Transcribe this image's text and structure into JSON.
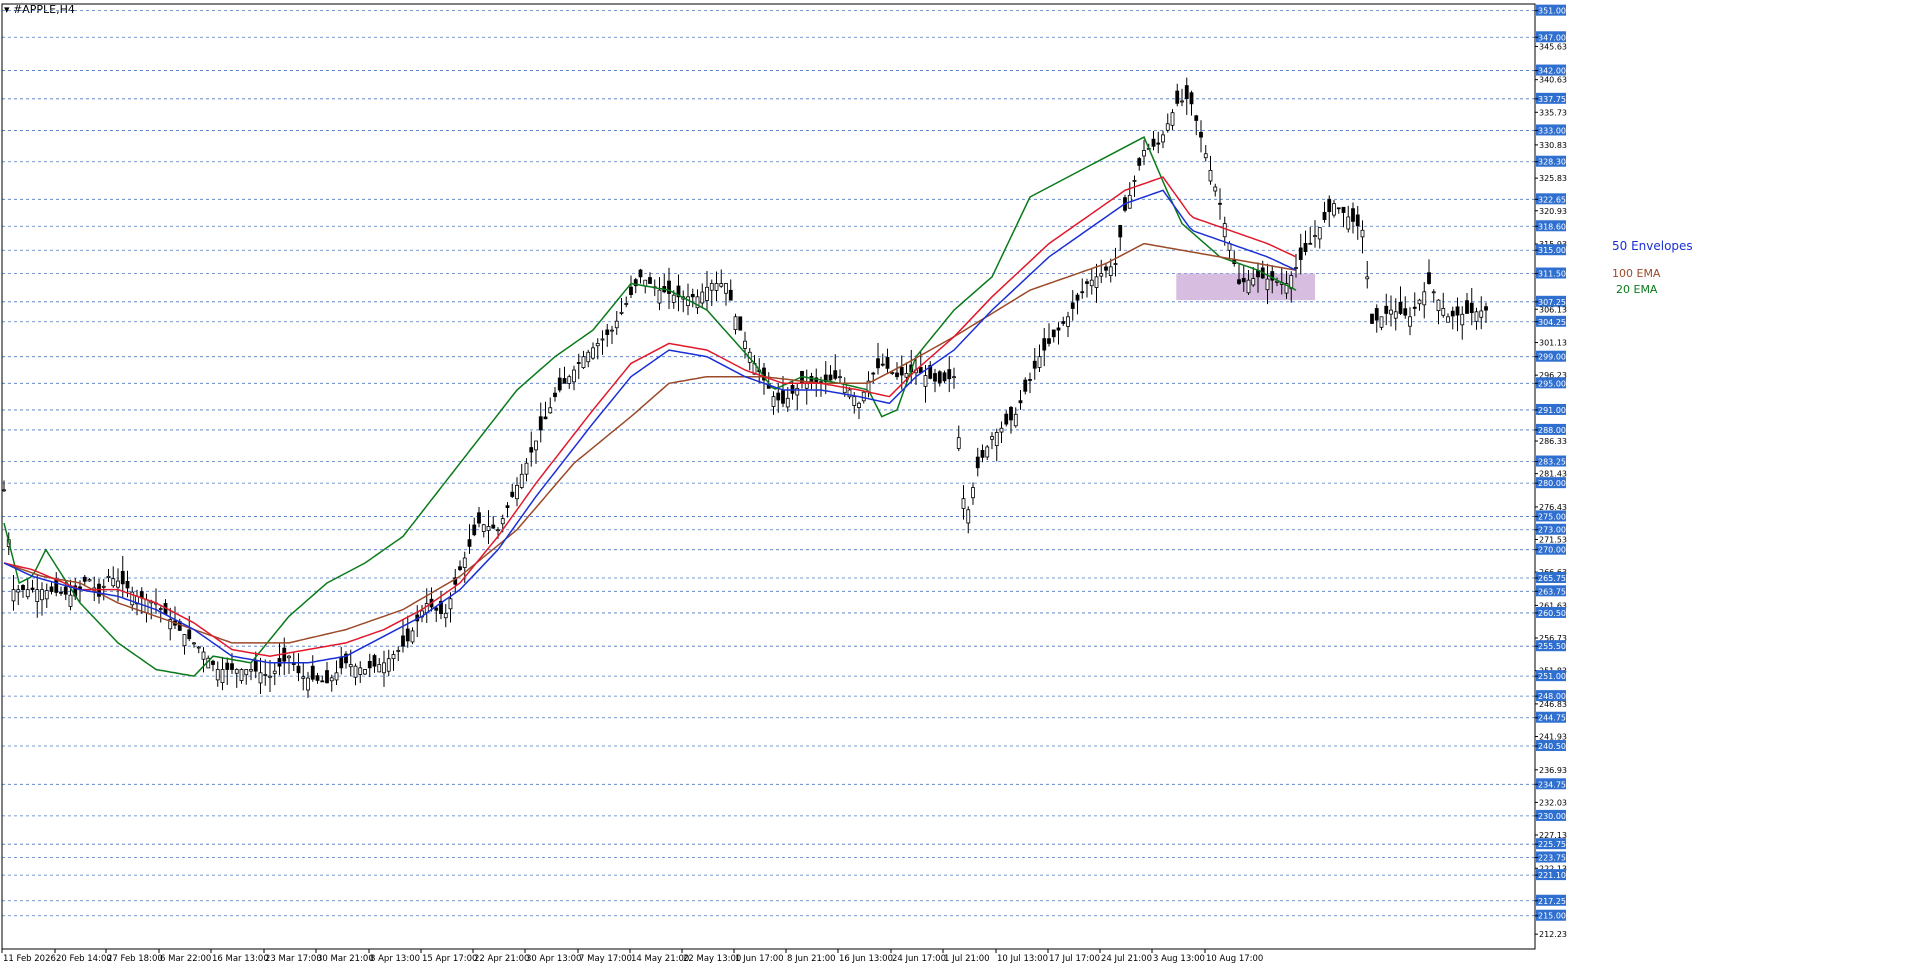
{
  "window": {
    "title": "▾ #APPLE,H4"
  },
  "colors": {
    "grid": "#4a78c8",
    "axis": "#000000",
    "candle": "#000000",
    "ema20": "#0a7a1a",
    "ema100": "#9b4a2a",
    "env_upper": "#e0192b",
    "env_lower": "#1a2fd6",
    "zone": "#c9a7d4",
    "tag_bg": "#2f6fd0",
    "tag_text": "#ffffff"
  },
  "annotations": {
    "envelopes": "50 Envelopes",
    "ema100": "100 EMA",
    "ema20": "20 EMA"
  },
  "chart_data": {
    "type": "candlestick",
    "symbol": "#APPLE",
    "timeframe": "H4",
    "ylim": [
      210,
      352
    ],
    "ticks": [
      "351.00",
      "347.00",
      "345.63",
      "342.00",
      "340.63",
      "337.75",
      "335.73",
      "333.00",
      "330.83",
      "328.30",
      "325.83",
      "322.65",
      "320.93",
      "318.60",
      "315.93",
      "315.00",
      "311.50",
      "307.25",
      "306.13",
      "304.25",
      "301.13",
      "299.00",
      "296.23",
      "295.00",
      "291.00",
      "288.00",
      "286.33",
      "283.25",
      "281.43",
      "280.00",
      "276.43",
      "275.00",
      "273.00",
      "271.53",
      "270.00",
      "266.63",
      "265.75",
      "263.75",
      "261.63",
      "260.50",
      "256.73",
      "255.50",
      "251.83",
      "251.00",
      "248.00",
      "246.83",
      "244.75",
      "241.93",
      "240.50",
      "236.93",
      "234.75",
      "232.03",
      "230.00",
      "227.13",
      "225.75",
      "223.75",
      "222.13",
      "221.10",
      "217.25",
      "215.00",
      "212.23"
    ],
    "tagged_levels": [
      351.0,
      347.0,
      342.0,
      337.75,
      333.0,
      328.3,
      322.65,
      318.6,
      315.0,
      311.5,
      307.25,
      304.25,
      299.0,
      295.0,
      291.0,
      288.0,
      283.25,
      280.0,
      275.0,
      273.0,
      270.0,
      265.75,
      263.75,
      260.5,
      255.5,
      251.0,
      248.0,
      244.75,
      240.5,
      234.75,
      230.0,
      225.75,
      223.75,
      221.1,
      217.25,
      215.0
    ],
    "x_labels": [
      "11 Feb 2026",
      "20 Feb 14:00",
      "27 Feb 18:00",
      "6 Mar 22:00",
      "16 Mar 13:00",
      "23 Mar 17:00",
      "30 Mar 21:00",
      "8 Apr 13:00",
      "15 Apr 17:00",
      "22 Apr 21:00",
      "30 Apr 13:00",
      "7 May 17:00",
      "14 May 21:00",
      "22 May 13:00",
      "1 Jun 17:00",
      "8 Jun 21:00",
      "16 Jun 13:00",
      "24 Jun 17:00",
      "1 Jul 21:00",
      "10 Jul 13:00",
      "17 Jul 17:00",
      "24 Jul 21:00",
      "3 Aug 13:00",
      "10 Aug 17:00"
    ],
    "bar_count": 247,
    "close_path": [
      [
        0,
        279
      ],
      [
        5,
        264
      ],
      [
        20,
        264
      ],
      [
        38,
        263
      ],
      [
        44,
        266
      ],
      [
        50,
        263
      ],
      [
        55,
        266
      ],
      [
        62,
        265
      ],
      [
        70,
        263
      ],
      [
        80,
        262
      ],
      [
        92,
        258
      ],
      [
        104,
        255
      ],
      [
        112,
        252
      ],
      [
        120,
        252
      ],
      [
        130,
        252
      ],
      [
        140,
        251
      ],
      [
        150,
        254
      ],
      [
        156,
        251
      ],
      [
        170,
        250
      ],
      [
        180,
        253
      ],
      [
        190,
        252
      ],
      [
        200,
        253
      ],
      [
        212,
        256
      ],
      [
        222,
        262
      ],
      [
        232,
        260
      ],
      [
        240,
        267
      ],
      [
        250,
        274
      ],
      [
        260,
        273
      ],
      [
        275,
        283
      ],
      [
        290,
        293
      ],
      [
        305,
        299
      ],
      [
        320,
        303
      ],
      [
        335,
        311
      ],
      [
        345,
        309
      ],
      [
        355,
        308
      ],
      [
        365,
        308
      ],
      [
        372,
        310
      ],
      [
        380,
        310
      ],
      [
        386,
        304
      ],
      [
        395,
        298
      ],
      [
        405,
        293
      ],
      [
        410,
        292
      ],
      [
        420,
        295
      ],
      [
        430,
        295
      ],
      [
        440,
        296
      ],
      [
        450,
        292
      ],
      [
        456,
        296
      ],
      [
        462,
        298
      ],
      [
        470,
        296
      ],
      [
        480,
        297
      ],
      [
        492,
        295
      ],
      [
        500,
        296
      ],
      [
        506,
        274
      ],
      [
        512,
        282
      ],
      [
        520,
        287
      ],
      [
        532,
        290
      ],
      [
        545,
        299
      ],
      [
        560,
        305
      ],
      [
        570,
        310
      ],
      [
        585,
        313
      ],
      [
        590,
        321
      ],
      [
        600,
        330
      ],
      [
        608,
        331
      ],
      [
        617,
        337
      ],
      [
        624,
        338
      ],
      [
        640,
        322
      ],
      [
        650,
        310
      ],
      [
        660,
        311
      ],
      [
        675,
        310
      ],
      [
        700,
        322
      ],
      [
        715,
        318
      ],
      [
        720,
        304
      ],
      [
        730,
        306
      ],
      [
        740,
        305
      ],
      [
        750,
        310
      ],
      [
        760,
        305
      ],
      [
        780,
        306
      ]
    ],
    "series": [
      {
        "name": "20 EMA",
        "values_path": [
          [
            0,
            274
          ],
          [
            8,
            265
          ],
          [
            15,
            266
          ],
          [
            22,
            270
          ],
          [
            40,
            262
          ],
          [
            60,
            256
          ],
          [
            80,
            252
          ],
          [
            100,
            251
          ],
          [
            110,
            254
          ],
          [
            130,
            253
          ],
          [
            150,
            260
          ],
          [
            170,
            265
          ],
          [
            190,
            268
          ],
          [
            210,
            272
          ],
          [
            240,
            283
          ],
          [
            270,
            294
          ],
          [
            290,
            299
          ],
          [
            310,
            303
          ],
          [
            330,
            310
          ],
          [
            350,
            309
          ],
          [
            370,
            306
          ],
          [
            395,
            298
          ],
          [
            405,
            294
          ],
          [
            420,
            296
          ],
          [
            440,
            295
          ],
          [
            455,
            294
          ],
          [
            462,
            290
          ],
          [
            470,
            291
          ],
          [
            480,
            299
          ],
          [
            500,
            306
          ],
          [
            520,
            311
          ],
          [
            540,
            323
          ],
          [
            560,
            326
          ],
          [
            580,
            329
          ],
          [
            600,
            332
          ],
          [
            612,
            324
          ],
          [
            620,
            319
          ],
          [
            640,
            314
          ],
          [
            660,
            312
          ],
          [
            680,
            309
          ]
        ]
      },
      {
        "name": "100 EMA",
        "values_path": [
          [
            0,
            268
          ],
          [
            20,
            266
          ],
          [
            40,
            265
          ],
          [
            60,
            262
          ],
          [
            90,
            259
          ],
          [
            120,
            256
          ],
          [
            150,
            256
          ],
          [
            180,
            258
          ],
          [
            210,
            261
          ],
          [
            240,
            266
          ],
          [
            270,
            273
          ],
          [
            300,
            283
          ],
          [
            330,
            290
          ],
          [
            350,
            295
          ],
          [
            370,
            296
          ],
          [
            400,
            296
          ],
          [
            430,
            295
          ],
          [
            455,
            295
          ],
          [
            475,
            298
          ],
          [
            500,
            302
          ],
          [
            540,
            309
          ],
          [
            580,
            313
          ],
          [
            600,
            316
          ],
          [
            620,
            315
          ],
          [
            640,
            314
          ],
          [
            680,
            312
          ]
        ]
      },
      {
        "name": "",
        "values_path": [
          [
            0,
            268
          ],
          [
            15,
            267
          ],
          [
            40,
            264
          ],
          [
            60,
            264
          ],
          [
            80,
            262
          ],
          [
            100,
            259
          ],
          [
            120,
            255
          ],
          [
            140,
            254
          ],
          [
            160,
            255
          ],
          [
            180,
            256
          ],
          [
            200,
            258
          ],
          [
            220,
            261
          ],
          [
            240,
            265
          ],
          [
            260,
            272
          ],
          [
            280,
            280
          ],
          [
            310,
            291
          ],
          [
            330,
            298
          ],
          [
            350,
            301
          ],
          [
            370,
            300
          ],
          [
            390,
            297
          ],
          [
            410,
            295
          ],
          [
            430,
            295
          ],
          [
            450,
            294
          ],
          [
            466,
            293
          ],
          [
            480,
            297
          ],
          [
            500,
            302
          ],
          [
            520,
            308
          ],
          [
            550,
            316
          ],
          [
            570,
            320
          ],
          [
            590,
            324
          ],
          [
            610,
            326
          ],
          [
            625,
            320
          ],
          [
            645,
            318
          ],
          [
            665,
            316
          ],
          [
            680,
            314
          ]
        ]
      },
      {
        "name": "",
        "values_path": [
          [
            0,
            268
          ],
          [
            15,
            266
          ],
          [
            40,
            264
          ],
          [
            60,
            263
          ],
          [
            80,
            261
          ],
          [
            100,
            258
          ],
          [
            120,
            254
          ],
          [
            140,
            253
          ],
          [
            160,
            253
          ],
          [
            180,
            254
          ],
          [
            200,
            257
          ],
          [
            220,
            260
          ],
          [
            240,
            264
          ],
          [
            260,
            270
          ],
          [
            280,
            278
          ],
          [
            310,
            289
          ],
          [
            330,
            296
          ],
          [
            350,
            300
          ],
          [
            370,
            299
          ],
          [
            390,
            296
          ],
          [
            410,
            294
          ],
          [
            430,
            294
          ],
          [
            450,
            293
          ],
          [
            466,
            292
          ],
          [
            480,
            296
          ],
          [
            500,
            300
          ],
          [
            520,
            306
          ],
          [
            550,
            314
          ],
          [
            570,
            318
          ],
          [
            590,
            322
          ],
          [
            610,
            324
          ],
          [
            625,
            318
          ],
          [
            645,
            316
          ],
          [
            665,
            314
          ],
          [
            680,
            312
          ]
        ]
      }
    ],
    "zone": {
      "x_bars": [
        617,
        690
      ],
      "y_range": [
        307.5,
        311.5
      ]
    }
  }
}
